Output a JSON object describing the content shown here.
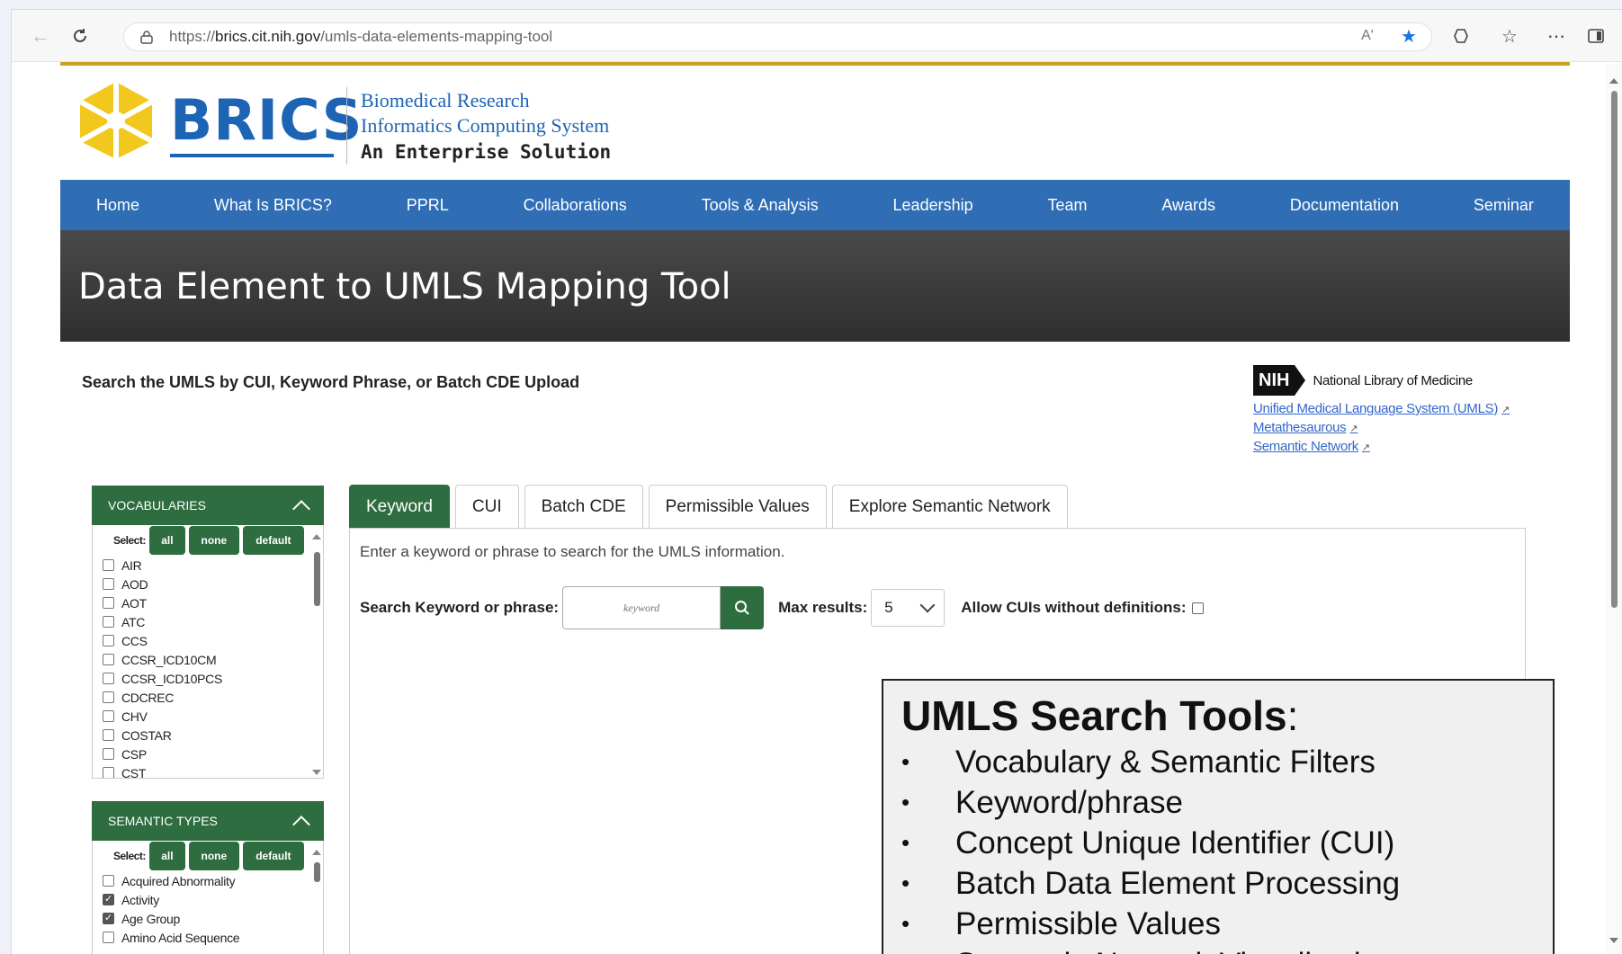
{
  "browser": {
    "url_scheme": "https://",
    "url_host": "brics.cit.nih.gov",
    "url_path": "/umls-data-elements-mapping-tool",
    "read_aloud_label": "Aʹ"
  },
  "header": {
    "logo_text": "BRICS",
    "tagline_line1": "Biomedical Research",
    "tagline_line2": "Informatics Computing System",
    "tagline_line3": "An Enterprise Solution",
    "accent_color": "#c9a422",
    "brand_color": "#1e64b4"
  },
  "nav": {
    "items": [
      "Home",
      "What Is BRICS?",
      "PPRL",
      "Collaborations",
      "Tools & Analysis",
      "Leadership",
      "Team",
      "Awards",
      "Documentation",
      "Seminar"
    ],
    "color": "#2f6db4"
  },
  "banner": {
    "title": "Data Element to UMLS Mapping Tool"
  },
  "intro": {
    "text": "Search the UMLS by CUI, Keyword Phrase, or Batch CDE Upload"
  },
  "nlm": {
    "badge": "NIH",
    "title": "National Library of Medicine",
    "links": [
      "Unified Medical Language System (UMLS)",
      "Metathesaurous",
      "Semantic Network"
    ]
  },
  "vocabularies": {
    "title": "VOCABULARIES",
    "select_label": "Select:",
    "buttons": [
      "all",
      "none",
      "default"
    ],
    "items": [
      "AIR",
      "AOD",
      "AOT",
      "ATC",
      "CCS",
      "CCSR_ICD10CM",
      "CCSR_ICD10PCS",
      "CDCREC",
      "CHV",
      "COSTAR",
      "CSP",
      "CST"
    ],
    "checked": [
      false,
      false,
      false,
      false,
      false,
      false,
      false,
      false,
      false,
      false,
      false,
      false
    ]
  },
  "semantic_types": {
    "title": "SEMANTIC TYPES",
    "select_label": "Select:",
    "buttons": [
      "all",
      "none",
      "default"
    ],
    "items": [
      "Acquired Abnormality",
      "Activity",
      "Age Group",
      "Amino Acid Sequence"
    ],
    "checked": [
      false,
      true,
      true,
      false
    ]
  },
  "tabs": {
    "items": [
      "Keyword",
      "CUI",
      "Batch CDE",
      "Permissible Values",
      "Explore Semantic Network"
    ],
    "active": "Keyword",
    "active_color": "#2e6d3f"
  },
  "search": {
    "hint": "Enter a keyword or phrase to search for the UMLS information.",
    "label": "Search Keyword or phrase:",
    "placeholder": "keyword",
    "max_label": "Max results:",
    "max_value": "5",
    "allow_label": "Allow CUIs without definitions:",
    "allow_checked": false
  },
  "overlay": {
    "title": "UMLS Search Tools",
    "title_suffix": ":",
    "bullet": "•",
    "items": [
      "Vocabulary & Semantic Filters",
      "Keyword/phrase",
      "Concept Unique Identifier (CUI)",
      "Batch Data Element Processing",
      "Permissible Values",
      "Semantic Network Visualization"
    ]
  }
}
